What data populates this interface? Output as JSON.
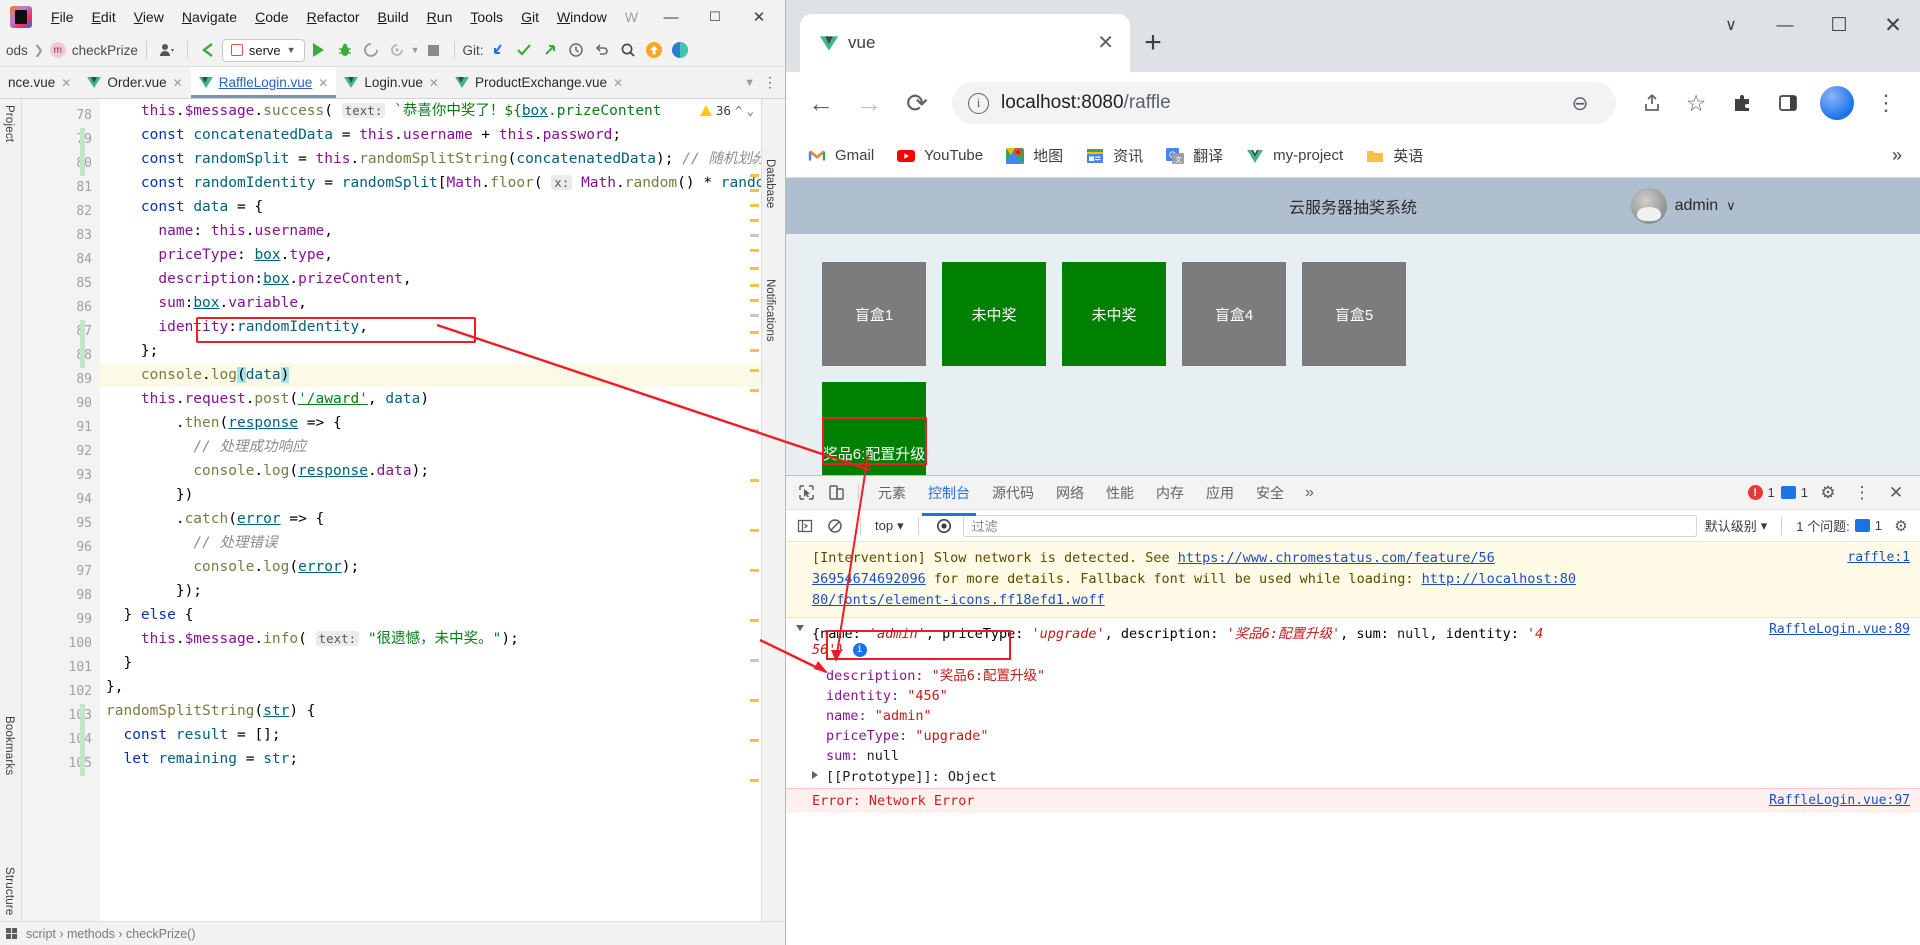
{
  "ide": {
    "menu": [
      "File",
      "Edit",
      "View",
      "Navigate",
      "Code",
      "Refactor",
      "Build",
      "Run",
      "Tools",
      "Git",
      "Window"
    ],
    "menu_dim": "W",
    "breadcrumb_prefix": "ods",
    "breadcrumb_method": "checkPrize",
    "method_badge": "m",
    "run_config": "serve",
    "git_label": "Git:",
    "window_minimize": "—",
    "window_maximize": "☐",
    "window_close": "✕",
    "left_rail_project": "Project",
    "left_rail_bookmarks": "Bookmarks",
    "left_rail_structure": "Structure",
    "right_rail_database": "Database",
    "right_rail_notifications": "Notifications",
    "warning_count": "36",
    "status_breadcrumb": "script › methods › checkPrize()",
    "tabs": [
      {
        "name": "nce.vue",
        "active": false
      },
      {
        "name": "Order.vue",
        "active": false
      },
      {
        "name": "RaffleLogin.vue",
        "active": true
      },
      {
        "name": "Login.vue",
        "active": false
      },
      {
        "name": "ProductExchange.vue",
        "active": false
      }
    ],
    "first_line_number": 78,
    "code_lines": [
      {
        "n": 78,
        "html": "    <span class='prop'>this</span>.<span class='prop'>$message</span>.<span class='fn'>success</span>( <span class='hint'>text:</span> <span class='str'>`恭喜你中奖了！${</span><span class='teal ul'>box</span><span class='str'>.prizeContent</span>"
      },
      {
        "n": 79,
        "html": "    <span class='kw'>const</span> <span class='teal'>concatenatedData</span> = <span class='prop'>this</span>.<span class='prop'>username</span> + <span class='prop'>this</span>.<span class='prop'>password</span>;"
      },
      {
        "n": 80,
        "html": "    <span class='kw'>const</span> <span class='teal'>randomSplit</span> = <span class='prop'>this</span>.<span class='fn'>randomSplitString</span>(<span class='teal'>concatenatedData</span>); <span class='cmt'>// 随机划分</span>"
      },
      {
        "n": 81,
        "html": "    <span class='kw'>const</span> <span class='teal'>randomIdentity</span> = <span class='teal'>randomSplit</span>[<span class='prop'>Math</span>.<span class='fn'>floor</span>( <span class='hint'>x:</span> <span class='prop'>Math</span>.<span class='fn'>random</span>() * <span class='teal'>random</span>"
      },
      {
        "n": 82,
        "html": "    <span class='kw'>const</span> <span class='teal'>data</span> = {"
      },
      {
        "n": 83,
        "html": "      <span class='prop'>name</span>: <span class='prop'>this</span>.<span class='prop'>username</span>,"
      },
      {
        "n": 84,
        "html": "      <span class='prop'>priceType</span>: <span class='teal ul'>box</span>.<span class='prop'>type</span>,"
      },
      {
        "n": 85,
        "html": "      <span class='prop'>description</span>:<span class='teal ul'>box</span>.<span class='prop'>prizeContent</span>,"
      },
      {
        "n": 86,
        "html": "      <span class='prop'>sum</span>:<span class='teal ul'>box</span>.<span class='prop'>variable</span>,"
      },
      {
        "n": 87,
        "html": "      <span class='prop'>identity</span>:<span class='teal'>randomIdentity</span>,"
      },
      {
        "n": 88,
        "html": "    };"
      },
      {
        "n": 89,
        "html": "    <span class='fn'>console</span>.<span class='fn'>log</span><span class='sel'>(</span><span class='teal'>data</span><span class='sel'>)</span>",
        "highlight": true
      },
      {
        "n": 90,
        "html": "    <span class='prop'>this</span>.<span class='prop'>request</span>.<span class='fn'>post</span>(<span class='str ul'>'/award'</span>, <span class='teal'>data</span>)"
      },
      {
        "n": 91,
        "html": "        .<span class='fn'>then</span>(<span class='teal ul'>response</span> =&gt; {"
      },
      {
        "n": 92,
        "html": "          <span class='cmt'>// 处理成功响应</span>"
      },
      {
        "n": 93,
        "html": "          <span class='fn'>console</span>.<span class='fn'>log</span>(<span class='teal ul'>response</span>.<span class='prop'>data</span>);"
      },
      {
        "n": 94,
        "html": "        })"
      },
      {
        "n": 95,
        "html": "        .<span class='fn'>catch</span>(<span class='teal ul'>error</span> =&gt; {"
      },
      {
        "n": 96,
        "html": "          <span class='cmt'>// 处理错误</span>"
      },
      {
        "n": 97,
        "html": "          <span class='fn'>console</span>.<span class='fn'>log</span>(<span class='teal ul'>error</span>);"
      },
      {
        "n": 98,
        "html": "        });"
      },
      {
        "n": 99,
        "html": "  } <span class='kw'>else</span> {"
      },
      {
        "n": 100,
        "html": "    <span class='prop'>this</span>.<span class='prop'>$message</span>.<span class='fn'>info</span>( <span class='hint'>text:</span> <span class='str'>\"很遗憾，未中奖。\"</span>);"
      },
      {
        "n": 101,
        "html": "  }"
      },
      {
        "n": 102,
        "html": "},"
      },
      {
        "n": 103,
        "html": "<span class='fn'>randomSplitString</span>(<span class='teal ul'>str</span>) {"
      },
      {
        "n": 104,
        "html": "  <span class='kw'>const</span> <span class='teal'>result</span> = [];"
      },
      {
        "n": 105,
        "html": "  <span class='kw'>let</span> <span class='teal'>remaining</span> = <span class='teal'>str</span>;"
      }
    ]
  },
  "browser": {
    "tab_title": "vue",
    "tab_close": "✕",
    "new_tab": "+",
    "window_minimize": "—",
    "window_maximize": "☐",
    "window_close": "✕",
    "window_chevron": "∨",
    "back": "←",
    "forward": "→",
    "reload": "⟳",
    "url": "localhost:8080/raffle",
    "url_host": "localhost:8080",
    "url_path": "/raffle",
    "info_glyph": "i",
    "zoom_out_icon": "⊖",
    "share_icon": "↪",
    "star_icon": "☆",
    "extensions_icon": "❖",
    "sidepanel_icon": "▧",
    "menu_icon": "⋮",
    "bookmarks": [
      {
        "label": "Gmail",
        "icon": "gmail-icon"
      },
      {
        "label": "YouTube",
        "icon": "youtube-icon"
      },
      {
        "label": "地图",
        "icon": "maps-icon"
      },
      {
        "label": "资讯",
        "icon": "news-icon"
      },
      {
        "label": "翻译",
        "icon": "translate-icon"
      },
      {
        "label": "my-project",
        "icon": "vue-icon"
      },
      {
        "label": "英语",
        "icon": "folder-icon"
      }
    ],
    "bookmarks_overflow": "»"
  },
  "app": {
    "title": "云服务器抽奖系统",
    "user": "admin",
    "user_chevron": "∨",
    "boxes_row1": [
      {
        "label": "盲盒1",
        "state": "gray"
      },
      {
        "label": "未中奖",
        "state": "green"
      },
      {
        "label": "未中奖",
        "state": "green"
      },
      {
        "label": "盲盒4",
        "state": "gray"
      },
      {
        "label": "盲盒5",
        "state": "gray"
      }
    ],
    "boxes_row2": [
      {
        "label": "奖品6:配置升级",
        "state": "green"
      }
    ]
  },
  "devtools": {
    "inspect_icon": "↖",
    "device_icon": "▭",
    "tabs": [
      {
        "label": "元素",
        "active": false
      },
      {
        "label": "控制台",
        "active": true
      },
      {
        "label": "源代码",
        "active": false
      },
      {
        "label": "网络",
        "active": false
      },
      {
        "label": "性能",
        "active": false
      },
      {
        "label": "内存",
        "active": false
      },
      {
        "label": "应用",
        "active": false
      },
      {
        "label": "安全",
        "active": false
      }
    ],
    "tabs_overflow": "»",
    "error_count": "1",
    "message_count": "1",
    "settings_icon": "⚙",
    "more_icon": "⋮",
    "close_icon": "✕",
    "console_sidebar_icon": "◳",
    "clear_icon": "⊘",
    "context": "top",
    "context_chevron": "▾",
    "eye_icon": "◉",
    "filter_placeholder": "过滤",
    "level_label": "默认级别",
    "level_chevron": "▾",
    "issues_label": "1 个问题:",
    "issues_count": "1",
    "settings_gear": "⚙",
    "intervention": {
      "text1": "[Intervention] Slow network is detected. See ",
      "link1": "https://www.chromestatus.com/feature/56",
      "link2": "36954674692096",
      "text2": " for more details. Fallback font will be used while loading: ",
      "link3": "http://localhost:80",
      "link4": "80/fonts/element-icons.ff18efd1.woff",
      "source": "raffle:1"
    },
    "log_object": {
      "source": "RaffleLogin.vue:89",
      "preview_prefix": "{name: ",
      "name_value": "'admin'",
      "pt_key": ", priceType: ",
      "pt_value": "'upgrade'",
      "desc_key": ", description: ",
      "desc_value": "'奖品6:配置升级'",
      "sum_key": ", sum: ",
      "sum_value": "null",
      "id_key": ", identity: ",
      "id_value": "'4",
      "id_value2": "56'}",
      "info_badge": "i",
      "rows": [
        {
          "key": "description:",
          "value": "\"奖品6:配置升级\"",
          "type": "string"
        },
        {
          "key": "identity:",
          "value": "\"456\"",
          "type": "string"
        },
        {
          "key": "name:",
          "value": "\"admin\"",
          "type": "string"
        },
        {
          "key": "priceType:",
          "value": "\"upgrade\"",
          "type": "string"
        },
        {
          "key": "sum:",
          "value": "null",
          "type": "null"
        }
      ],
      "prototype": "[[Prototype]]: Object"
    },
    "error_line": "Error: Network Error",
    "error_source": "RaffleLogin.vue:97"
  },
  "colors": {
    "accent_blue": "#1a73e8",
    "annotation_red": "#ee1c25",
    "box_green": "#008000",
    "box_gray": "#7c7c7c",
    "app_header": "#b0bfd0"
  }
}
